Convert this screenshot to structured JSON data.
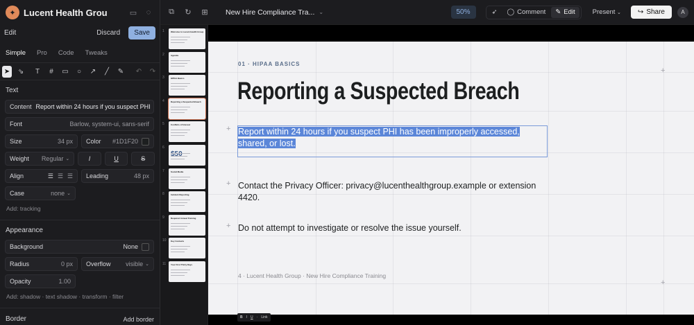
{
  "project": {
    "title": "Lucent Health Group trai..."
  },
  "edit_bar": {
    "label": "Edit",
    "discard": "Discard",
    "save": "Save"
  },
  "tabs": [
    "Simple",
    "Pro",
    "Code",
    "Tweaks"
  ],
  "text_section": {
    "title": "Text",
    "content_label": "Content",
    "content_value": "Report within 24 hours if you suspect PHI",
    "font_label": "Font",
    "font_value": "Barlow, system-ui, sans-serif",
    "size_label": "Size",
    "size_value": "34 px",
    "color_label": "Color",
    "color_value": "#1D1F20",
    "weight_label": "Weight",
    "weight_value": "Regular",
    "italic": "I",
    "underline": "U",
    "strike": "S",
    "align_label": "Align",
    "leading_label": "Leading",
    "leading_value": "48 px",
    "case_label": "Case",
    "case_value": "none",
    "add_tracking": "Add: tracking"
  },
  "appearance_section": {
    "title": "Appearance",
    "background_label": "Background",
    "background_value": "None",
    "radius_label": "Radius",
    "radius_value": "0 px",
    "overflow_label": "Overflow",
    "overflow_value": "visible",
    "opacity_label": "Opacity",
    "opacity_value": "1.00",
    "add_more": "Add: shadow · text shadow · transform · filter"
  },
  "border_section": {
    "title": "Border",
    "add": "Add border"
  },
  "topbar": {
    "doc_title": "New Hire Compliance Tra...",
    "zoom": "50%",
    "comment": "Comment",
    "edit": "Edit",
    "present": "Present",
    "share": "Share",
    "avatar": "A"
  },
  "thumbnails": [
    {
      "num": "1",
      "title": "Welcome to Lucent Health Group"
    },
    {
      "num": "2",
      "title": "Agenda"
    },
    {
      "num": "3",
      "title": "HIPAA Basics"
    },
    {
      "num": "4",
      "title": "Reporting a Suspected Breach"
    },
    {
      "num": "5",
      "title": "Conflicts of Interest"
    },
    {
      "num": "6",
      "title": "",
      "big": "$50"
    },
    {
      "num": "7",
      "title": "Social Media"
    },
    {
      "num": "8",
      "title": "Incident Reporting"
    },
    {
      "num": "9",
      "title": "Required Annual Training"
    },
    {
      "num": "10",
      "title": "Key Contacts"
    },
    {
      "num": "11",
      "title": "Your First Thirty Days"
    }
  ],
  "slide": {
    "kicker": "01 · HIPAA BASICS",
    "title": "Reporting a Suspected Breach",
    "bullets": [
      "Report within 24 hours if you suspect PHI has been improperly accessed, shared, or lost.",
      "Contact the Privacy Officer: privacy@lucenthealthgroup.example or extension 4420.",
      "Do not attempt to investigate or resolve the issue yourself."
    ],
    "footer": "4 · Lucent Health Group · New Hire Compliance Training"
  },
  "mini_toolbar": [
    "B",
    "I",
    "U",
    "·",
    "Link"
  ],
  "colors": {
    "accent": "#8fb0e0",
    "selection": "#5b86d8",
    "text": "#1D1F20",
    "slide_bg": "#f2f2f4"
  }
}
